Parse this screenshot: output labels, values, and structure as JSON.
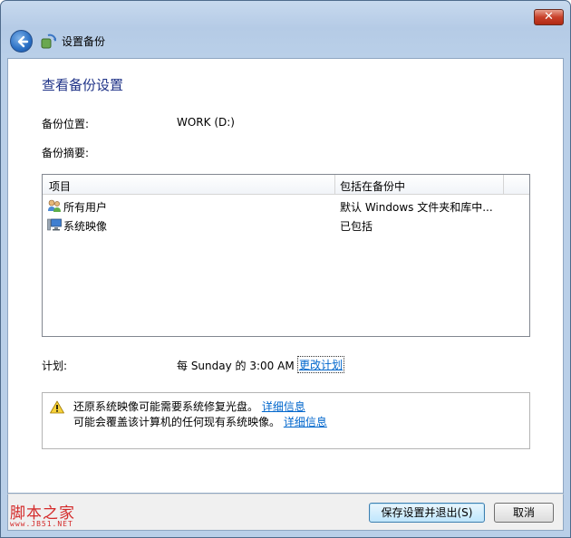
{
  "window": {
    "title": "设置备份",
    "close_glyph": "✕"
  },
  "page": {
    "heading": "查看备份设置",
    "location_label": "备份位置:",
    "location_value": "WORK (D:)",
    "summary_label": "备份摘要:"
  },
  "table": {
    "columns": [
      "项目",
      "包括在备份中"
    ],
    "rows": [
      {
        "icon": "users-icon",
        "item": "所有用户",
        "included": "默认 Windows 文件夹和库中..."
      },
      {
        "icon": "system-image-icon",
        "item": "系统映像",
        "included": "已包括"
      }
    ]
  },
  "schedule": {
    "label": "计划:",
    "value": "每 Sunday 的 3:00 AM",
    "change_link": "更改计划"
  },
  "warnings": [
    {
      "text": "还原系统映像可能需要系统修复光盘。",
      "link": "详细信息"
    },
    {
      "text": "可能会覆盖该计算机的任何现有系统映像。",
      "link": "详细信息"
    }
  ],
  "buttons": {
    "save_exit": "保存设置并退出(S)",
    "cancel": "取消"
  },
  "watermark": {
    "text": "脚本之家",
    "url": "www.JB51.NET"
  },
  "colors": {
    "heading": "#1e3287",
    "link": "#0066cc",
    "watermark": "#d42a2a"
  }
}
